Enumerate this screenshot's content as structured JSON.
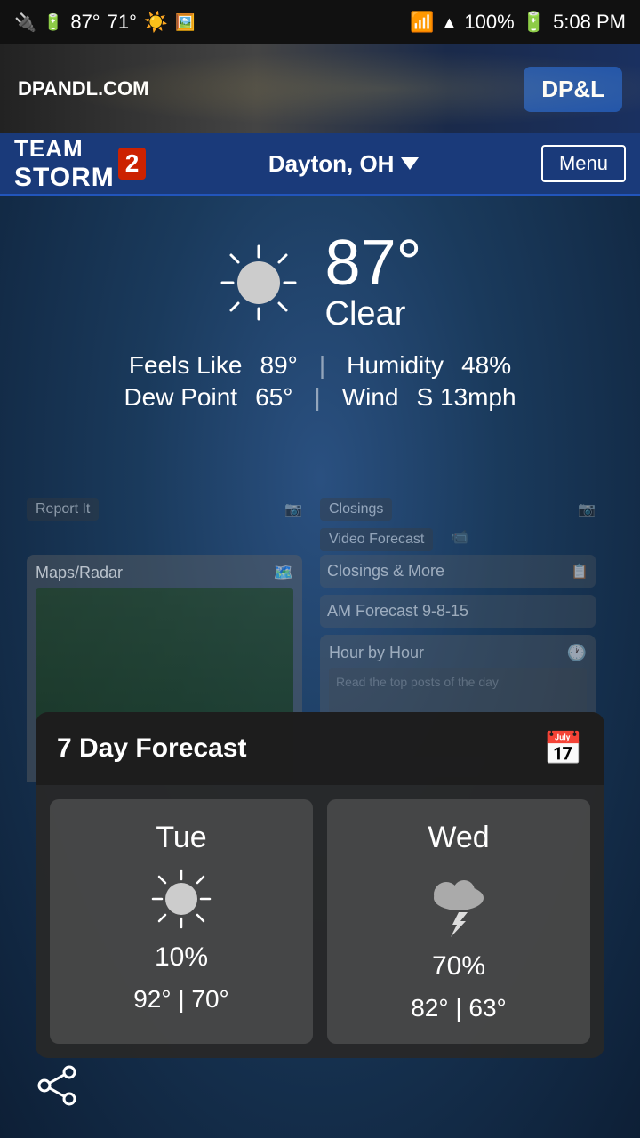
{
  "statusBar": {
    "temperature": "87°",
    "tempLow": "71°",
    "battery": "100%",
    "time": "5:08 PM"
  },
  "adBanner": {
    "url": "DPANDL.COM",
    "logo": "DP&L"
  },
  "header": {
    "appName": "STORM",
    "appNum": "2",
    "team": "TEAM",
    "location": "Dayton, OH",
    "menuLabel": "Menu"
  },
  "currentWeather": {
    "temp": "87°",
    "condition": "Clear",
    "feelsLike": "Feels Like",
    "feelsLikeVal": "89°",
    "humidity": "Humidity",
    "humidityVal": "48%",
    "dewPoint": "Dew Point",
    "dewPointVal": "65°",
    "wind": "Wind",
    "windVal": "S 13mph"
  },
  "taskCards": [
    {
      "title": "Maps/Radar",
      "icon": "map"
    },
    {
      "title": "Hour by Hour",
      "icon": "clock"
    }
  ],
  "backgroundTabs": [
    {
      "label": "Report It"
    },
    {
      "label": "Closings"
    },
    {
      "label": "Video Forecast"
    },
    {
      "label": "Closings & More"
    },
    {
      "label": "AM Forecast 9-8-15"
    }
  ],
  "forecastCard": {
    "title": "7 Day Forecast",
    "calendarIcon": "📅",
    "days": [
      {
        "name": "Tue",
        "weatherType": "sunny",
        "precip": "10%",
        "high": "92°",
        "low": "70°"
      },
      {
        "name": "Wed",
        "weatherType": "thunderstorm",
        "precip": "70%",
        "high": "82°",
        "low": "63°"
      }
    ]
  },
  "shareButton": {
    "label": "Share"
  }
}
